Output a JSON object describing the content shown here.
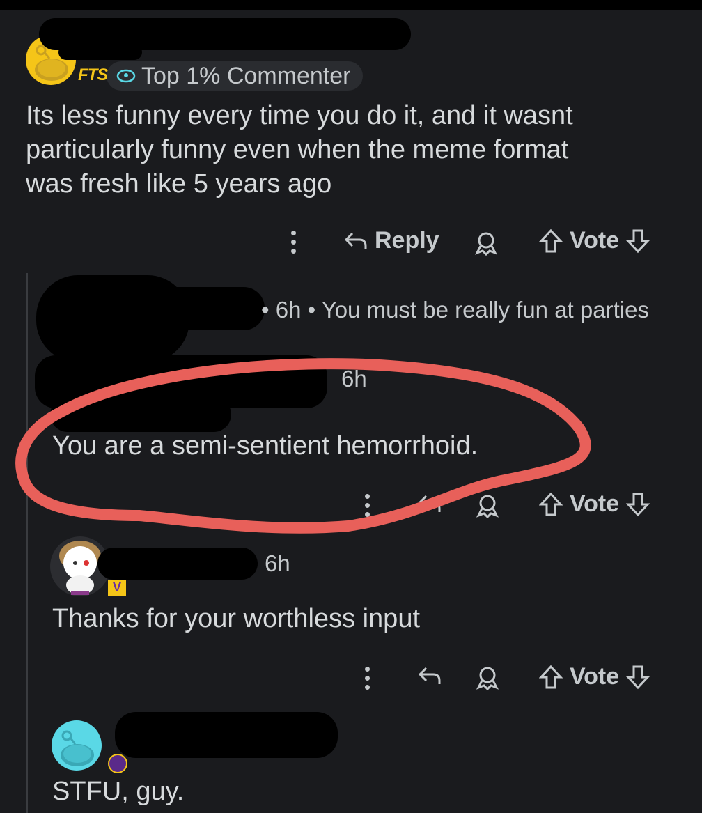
{
  "comments": [
    {
      "flair": "FTS",
      "badge": "Top 1% Commenter",
      "text_lines": [
        "Its less funny every time you do it, and it wasnt",
        "particularly funny even when the meme format",
        "was fresh like 5 years ago"
      ],
      "actions": {
        "reply": "Reply",
        "vote": "Vote"
      }
    },
    {
      "meta": "• 6h • You must be really fun at parties"
    },
    {
      "meta": "6h",
      "text": "You are a semi-sentient hemorrhoid.",
      "actions": {
        "vote": "Vote"
      }
    },
    {
      "meta": "6h",
      "text": "Thanks for your worthless input",
      "actions": {
        "vote": "Vote"
      }
    },
    {
      "text": "STFU, guy."
    }
  ],
  "colors": {
    "background": "#1a1b1e",
    "text": "#d7dadc",
    "annotation_circle": "#e8605a",
    "avatar_yellow": "#f5c518",
    "avatar_cyan": "#5ad8e6"
  },
  "icons": [
    "reddit-snoo-avatar",
    "more-options-icon",
    "reply-icon",
    "award-icon",
    "upvote-icon",
    "downvote-icon"
  ]
}
